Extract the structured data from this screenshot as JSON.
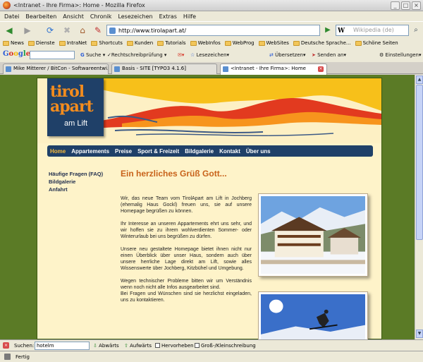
{
  "window": {
    "title": "<Intranet - Ihre Firma>: Home - Mozilla Firefox",
    "controls": [
      "_",
      "□",
      "×"
    ]
  },
  "menu": [
    "Datei",
    "Bearbeiten",
    "Ansicht",
    "Chronik",
    "Lesezeichen",
    "Extras",
    "Hilfe"
  ],
  "nav": {
    "url": "http://www.tirolapart.at/",
    "search_placeholder": "Wikipedia (de)",
    "search_engine_letter": "W"
  },
  "bookmarks": [
    "News",
    "Dienste",
    "IntraNet",
    "Shortcuts",
    "Kunden",
    "Tutorials",
    "WebInfos",
    "WebProg",
    "WebSites",
    "Deutsche Sprache...",
    "Schöne Seiten"
  ],
  "google_toolbar": {
    "logo": [
      "G",
      "o",
      "o",
      "g",
      "l",
      "e"
    ],
    "items": [
      "Suche",
      "Rechtschreibprüfung",
      "Lesezeichen",
      "Übersetzen",
      "Senden an",
      "Einstellungen"
    ]
  },
  "tabs": [
    {
      "label": "Mike Mitterer / BitCon - Softwareentwi...",
      "active": false
    },
    {
      "label": "Basis - SITE [TYPO3 4.1.6]",
      "active": false
    },
    {
      "label": "<Intranet - Ihre Firma>: Home",
      "active": true
    }
  ],
  "site": {
    "logo": {
      "line1": "tirol",
      "line2": "apart",
      "line3": "am Lift"
    },
    "nav": [
      "Home",
      "Appartements",
      "Preise",
      "Sport & Freizeit",
      "Bildgalerie",
      "Kontakt",
      "Über uns"
    ],
    "sidebar": [
      "Häufige Fragen (FAQ)",
      "Bildgalerie",
      "Anfahrt"
    ],
    "headline": "Ein herzliches Grüß Gott...",
    "paragraphs": [
      "Wir, das neue Team vom TirolApart am Lift in Jochberg (ehemalig Haus Gockl) freuen uns, sie auf unsere Homepage begrüßen zu können.",
      "Ihr Interesse an unseren Appartements ehrt uns sehr, und wir hoffen sie zu ihrem wohlverdienten Sommer- oder Winterurlaub bei uns begrüßen zu dürfen.",
      "Unsere neu gestaltete Homepage bietet ihnen nicht nur einen Überblick über unser Haus, sondern auch über unsere herrliche Lage direkt am Lift, sowie alles Wissenswerte über Jochberg, Kitzbühel und Umgebung.",
      "Wegen technischer Probleme bitten wir um Verständnis wenn noch nicht alle Infos ausgearbeitet sind.\nBei Fragen und Wünschen sind sie herzlichst eingeladen, uns zu kontaktieren."
    ]
  },
  "findbar": {
    "label": "Suchen:",
    "value": "hotelm",
    "down": "Abwärts",
    "up": "Aufwärts",
    "highlight": "Hervorheben",
    "case": "Groß-/Kleinschreibung"
  },
  "status": "Fertig",
  "colors": {
    "page_bg": "#5b7b26",
    "nav_blue": "#1f4068",
    "accent_orange": "#c8621a",
    "content_bg": "#fef3c9"
  }
}
